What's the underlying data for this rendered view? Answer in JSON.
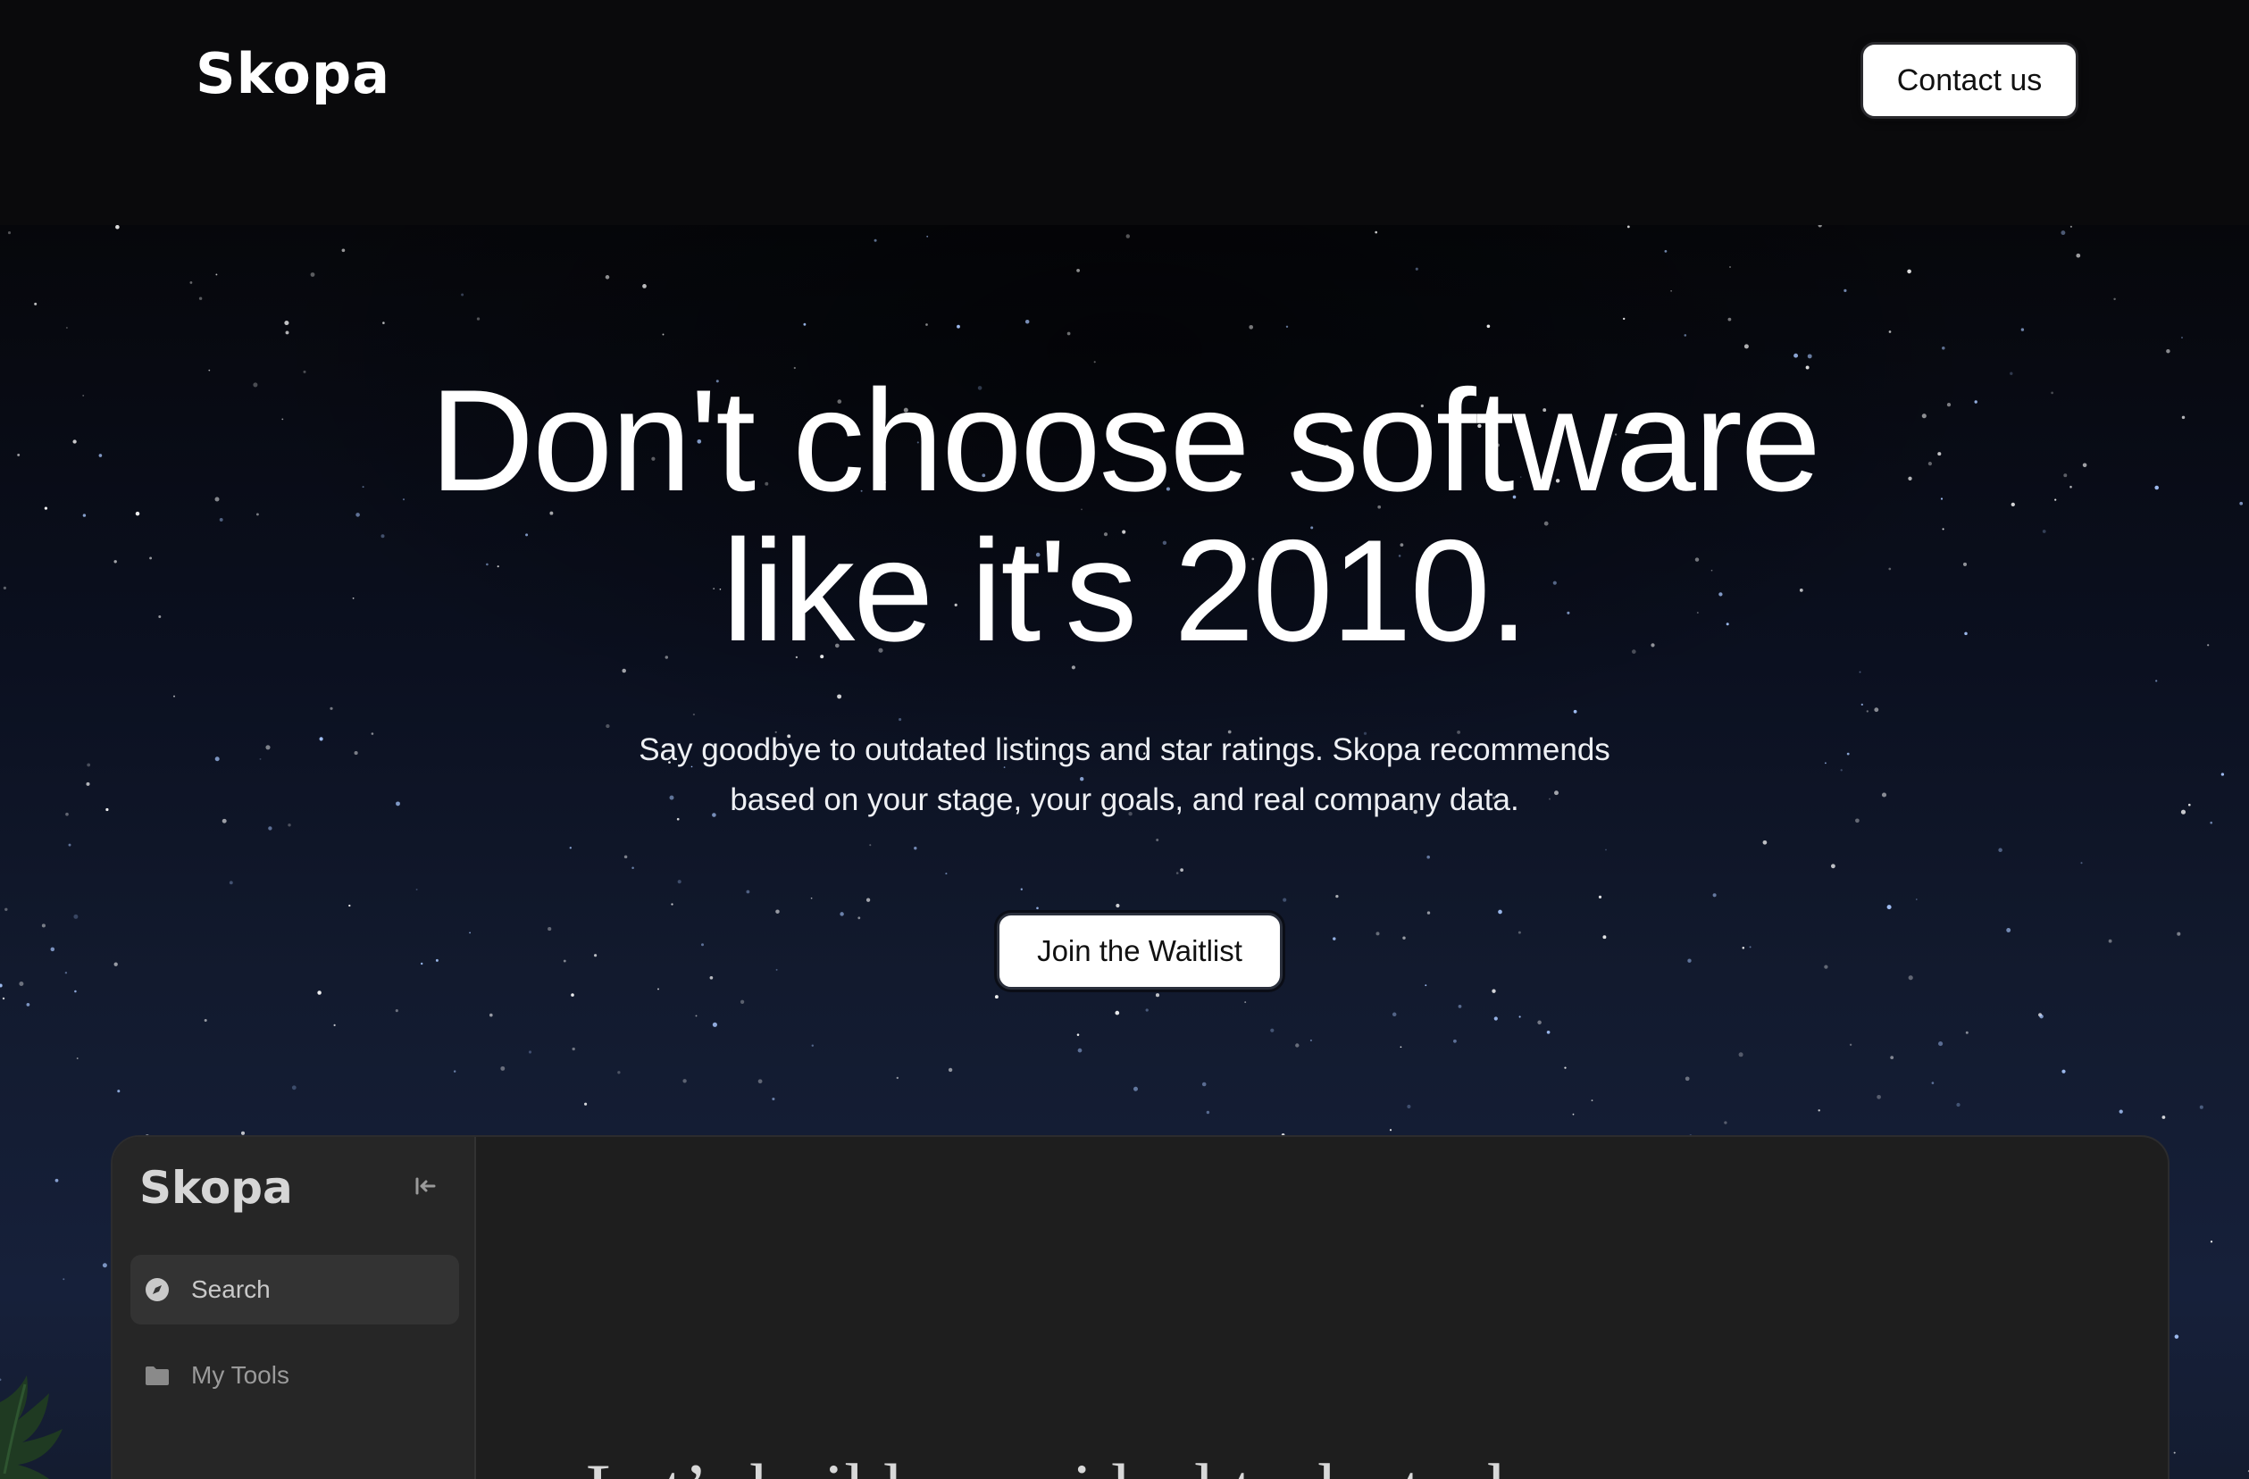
{
  "header": {
    "logo": "Skopa",
    "contact_label": "Contact us"
  },
  "hero": {
    "headline_lines": [
      "Don't choose software",
      "like it's 2010."
    ],
    "subtext_lines": [
      "Say goodbye to outdated listings and star ratings. Skopa recommends",
      "based on your stage, your goals, and real company data."
    ],
    "cta_label": "Join the Waitlist"
  },
  "app_preview": {
    "logo": "Skopa",
    "nav": [
      {
        "label": "Search",
        "icon": "compass-icon",
        "active": true
      },
      {
        "label": "My Tools",
        "icon": "folder-icon",
        "active": false
      }
    ],
    "main_text": "Let’s build your ideal tech stack"
  },
  "colors": {
    "background": "#0a0a0c",
    "button_bg": "#ffffff",
    "button_text": "#111111",
    "app_bg": "#1e1e1e",
    "sidebar_bg": "#262626"
  }
}
